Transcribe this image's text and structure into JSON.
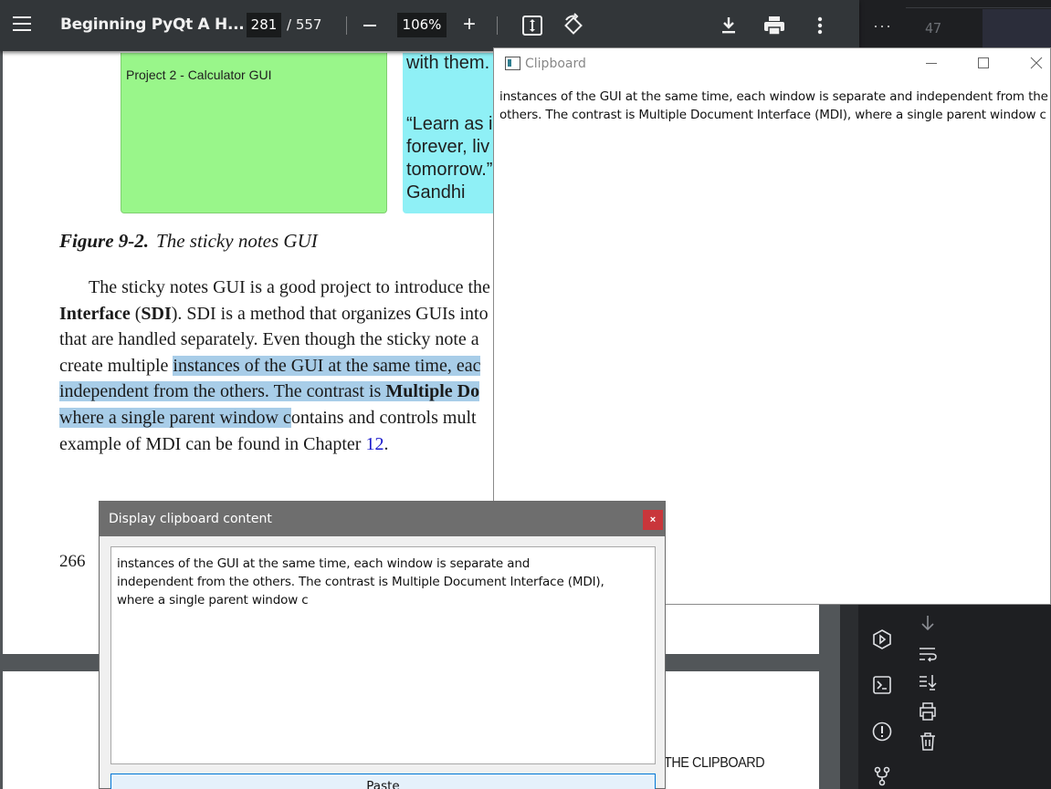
{
  "pdf_viewer": {
    "title": "Beginning PyQt A H...",
    "current_page": "281",
    "total_pages": "/ 557",
    "zoom": "106%",
    "zoom_plus": "+",
    "icons": [
      "menu-icon",
      "zoom-out-icon",
      "zoom-in-icon",
      "fit-page-icon",
      "rotate-icon",
      "download-icon",
      "print-icon",
      "more-vert-icon"
    ]
  },
  "page": {
    "sticky_green_text": "Project 2 - Calculator GUI",
    "sticky_cyan_top": "with them.",
    "sticky_cyan_quote": "“Learn as i\nforever, liv\ntomorrow.”\nGandhi",
    "figure_label": "Figure 9-2.",
    "figure_title": "The sticky notes GUI",
    "para_l1_a": "The sticky notes GUI is a good project to introduce the",
    "para_l2_a": "Interface",
    "para_l2_b": " (",
    "para_l2_c": "SDI",
    "para_l2_d": "). SDI is a method that organizes GUIs into",
    "para_l3": "that are handled separately. Even though the sticky note a",
    "para_l4_a": "create multiple ",
    "para_l4_b": "instances of the GUI at the same time, eac",
    "para_l5_a": "independent from the others. The contrast is ",
    "para_l5_b": "Multiple Do",
    "para_l6_a": "where a single parent window c",
    "para_l6_b": "ontains and controls mult",
    "para_l7_a": "example of MDI can be found in Chapter ",
    "para_l7_link": "12",
    "para_l7_b": ".",
    "page_number": "266",
    "running_head": "THE CLIPBOARD"
  },
  "clipboard_window": {
    "title": "Clipboard",
    "content": "instances of the GUI at the same time, each window is separate and independent from the\nothers. The contrast is Multiple Document Interface (MDI), where a single parent window c"
  },
  "display_dialog": {
    "title": "Display clipboard content",
    "close_label": "×",
    "text_content": "instances of the GUI at the same time, each window is separate and\nindependent from the others. The contrast is Multiple Document Interface (MDI),\nwhere a single parent window c",
    "paste_label": "Paste"
  },
  "ide_panel": {
    "more_label": "···",
    "line_number": "47",
    "icons": [
      "run-icon",
      "terminal-icon",
      "problems-icon",
      "git-branch-icon",
      "arrow-down-icon",
      "soft-wrap-icon",
      "scroll-to-end-icon",
      "print-icon",
      "trash-icon"
    ]
  },
  "colors": {
    "toolbar_bg": "#323639",
    "highlight": "#a8cde8",
    "sticky_green": "#99f68a",
    "sticky_cyan": "#8ff0f6",
    "dialog_close": "#c9363b"
  }
}
